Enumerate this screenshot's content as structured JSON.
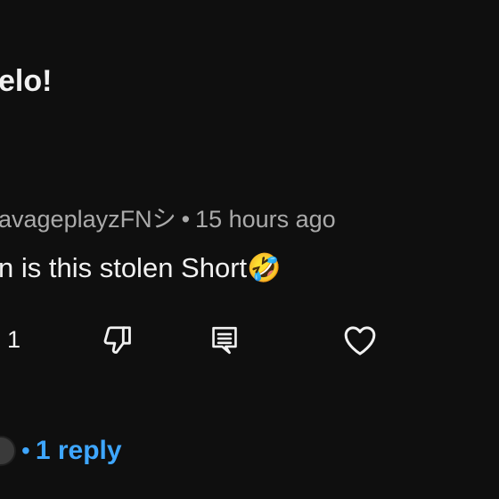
{
  "previous_comment": {
    "text": "elo!"
  },
  "comment": {
    "author": "avageplayzFNシ",
    "separator": "•",
    "timestamp": "15 hours ago",
    "text": "n is this stolen Short🤣",
    "like_count": "1"
  },
  "actions": {
    "dislike_icon": "thumbs-down-icon",
    "reply_icon": "reply-comment-icon",
    "heart_icon": "heart-icon"
  },
  "replies": {
    "separator": "•",
    "label": "1 reply",
    "color": "#3ea6ff"
  },
  "colors": {
    "background": "#0f0f0f",
    "text_primary": "#f1f1f1",
    "text_secondary": "#aaaaaa",
    "link_blue": "#3ea6ff"
  }
}
